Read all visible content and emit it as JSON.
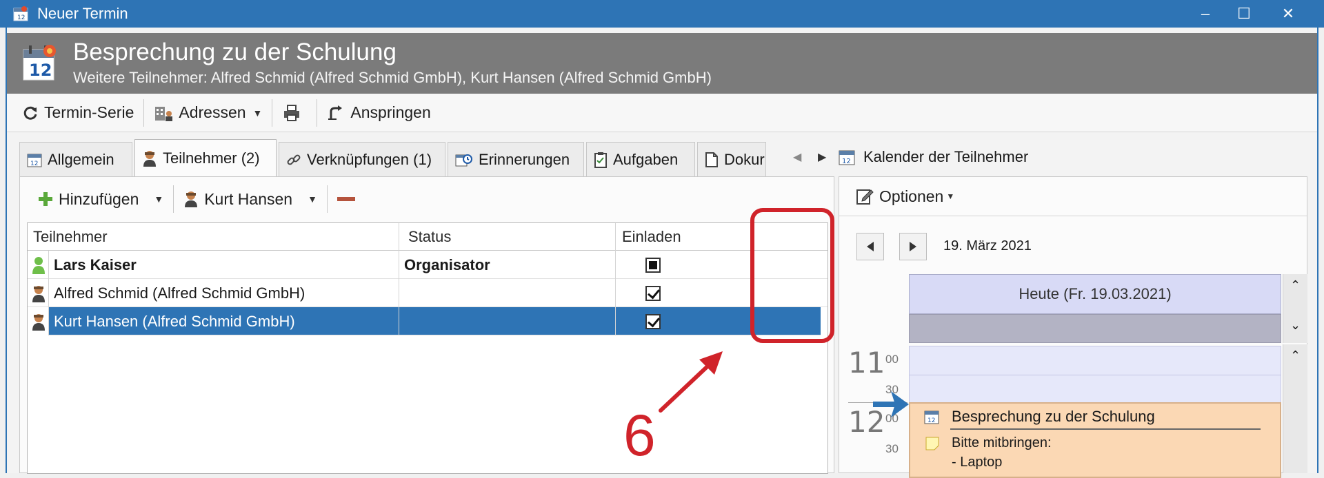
{
  "window": {
    "title": "Neuer Termin",
    "minimize": "–",
    "maximize": "☐",
    "close": "✕"
  },
  "header": {
    "title": "Besprechung zu der Schulung",
    "subtitle": "Weitere Teilnehmer: Alfred Schmid (Alfred Schmid GmbH), Kurt Hansen (Alfred Schmid GmbH)"
  },
  "toolbar": {
    "series": "Termin-Serie",
    "addresses": "Adressen",
    "jump": "Anspringen"
  },
  "tabs": [
    {
      "label": "Allgemein"
    },
    {
      "label": "Teilnehmer (2)"
    },
    {
      "label": "Verknüpfungen (1)"
    },
    {
      "label": "Erinnerungen"
    },
    {
      "label": "Aufgaben"
    },
    {
      "label": "Dokur"
    }
  ],
  "participants": {
    "add": "Hinzufügen",
    "selected": "Kurt Hansen",
    "columns": {
      "name": "Teilnehmer",
      "status": "Status",
      "invite": "Einladen"
    },
    "rows": [
      {
        "name": "Lars Kaiser",
        "status": "Organisator",
        "invite": "indeterminate"
      },
      {
        "name": "Alfred Schmid (Alfred Schmid GmbH)",
        "status": "",
        "invite": "checked"
      },
      {
        "name": "Kurt Hansen (Alfred Schmid GmbH)",
        "status": "",
        "invite": "checked"
      }
    ]
  },
  "calendar": {
    "title": "Kalender der Teilnehmer",
    "options": "Optionen",
    "date": "19. März 2021",
    "day_header": "Heute (Fr. 19.03.2021)",
    "hours": [
      "11",
      "12"
    ],
    "minutes": [
      "00",
      "30",
      "00",
      "30"
    ],
    "appointment": {
      "title": "Besprechung zu der Schulung",
      "note_line1": "Bitte mitbringen:",
      "note_line2": "- Laptop"
    }
  },
  "annotation": {
    "number": "6"
  },
  "colors": {
    "titlebar": "#2e74b5",
    "header": "#7b7b7b",
    "selection": "#2e74b5",
    "annotation": "#d0232a",
    "appointment": "#fbd8b4",
    "day_header": "#d8daf6"
  }
}
